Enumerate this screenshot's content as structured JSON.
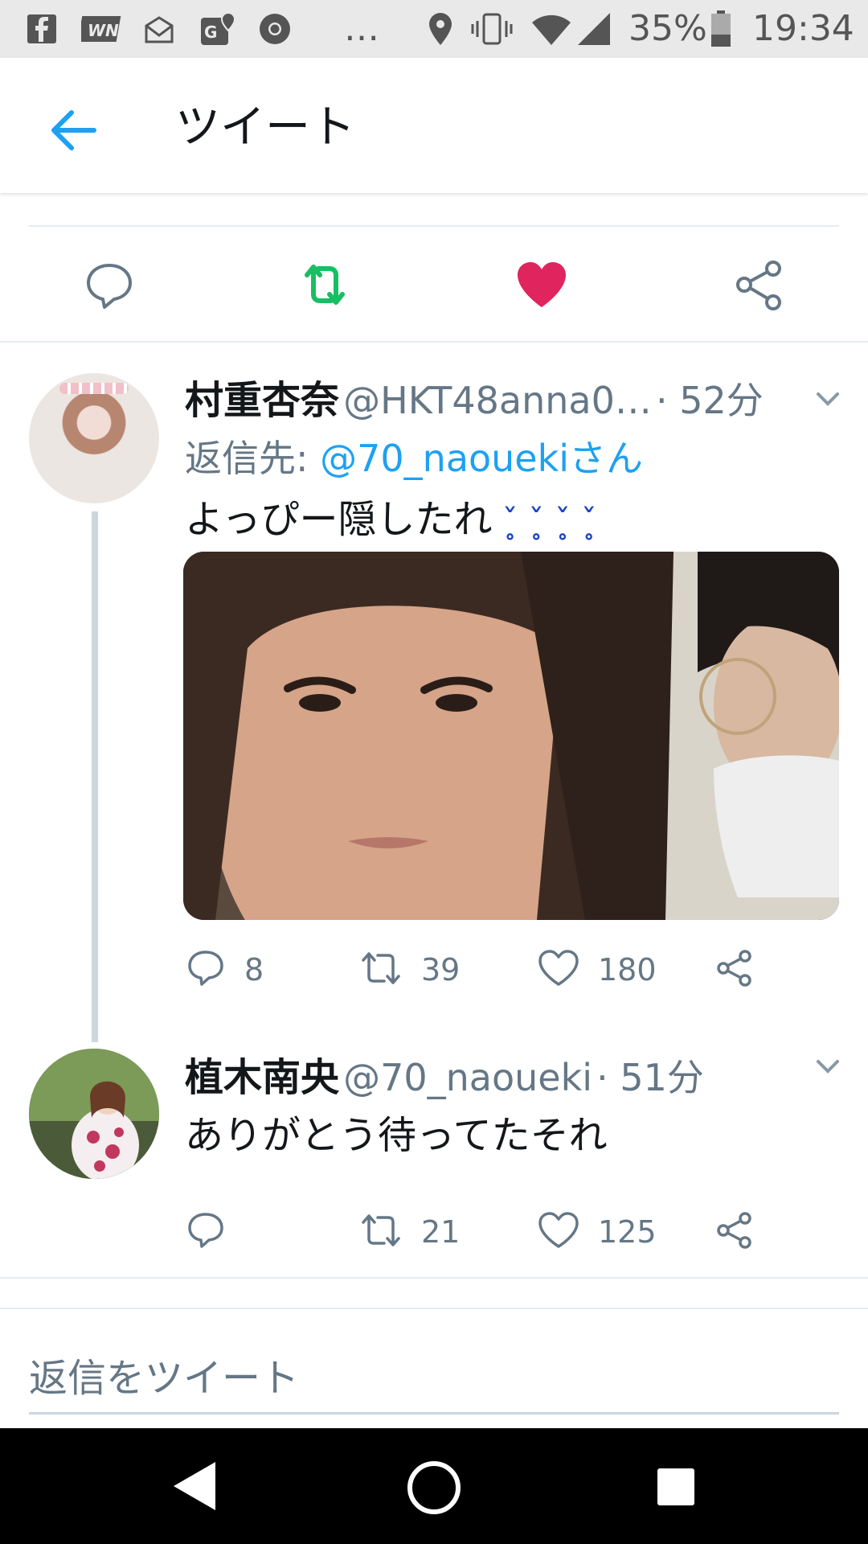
{
  "status_bar": {
    "notification_icons": [
      "facebook-icon",
      "wn-icon",
      "mail-icon",
      "gmaps-icon",
      "chrome-icon",
      "more-icon"
    ],
    "overflow": "…",
    "battery_percent": "35%",
    "time": "19:34"
  },
  "header": {
    "title": "ツイート"
  },
  "main_tweet_actions": {
    "retweeted": true,
    "liked": true,
    "colors": {
      "retweet": "#17bf63",
      "like": "#e0245e"
    }
  },
  "replies": [
    {
      "display_name": "村重杏奈",
      "handle": "@HKT48anna0…",
      "time": "· 52分",
      "reply_to_label": "返信先:",
      "reply_to_handle": "@70_naouekiさん",
      "text": "よっぴー隠したれ",
      "emoji": "ˇ̥ ˇ̥ ˇ̥ ˇ̥",
      "counts": {
        "reply": "8",
        "retweet": "39",
        "like": "180"
      }
    },
    {
      "display_name": "植木南央",
      "handle": "@70_naoueki",
      "time": "· 51分",
      "text": "ありがとう待ってたそれ",
      "counts": {
        "reply": "",
        "retweet": "21",
        "like": "125"
      }
    }
  ],
  "compose": {
    "placeholder": "返信をツイート"
  },
  "colors": {
    "accent": "#1da1f2",
    "muted": "#657786",
    "divider": "#e6ecf0"
  }
}
